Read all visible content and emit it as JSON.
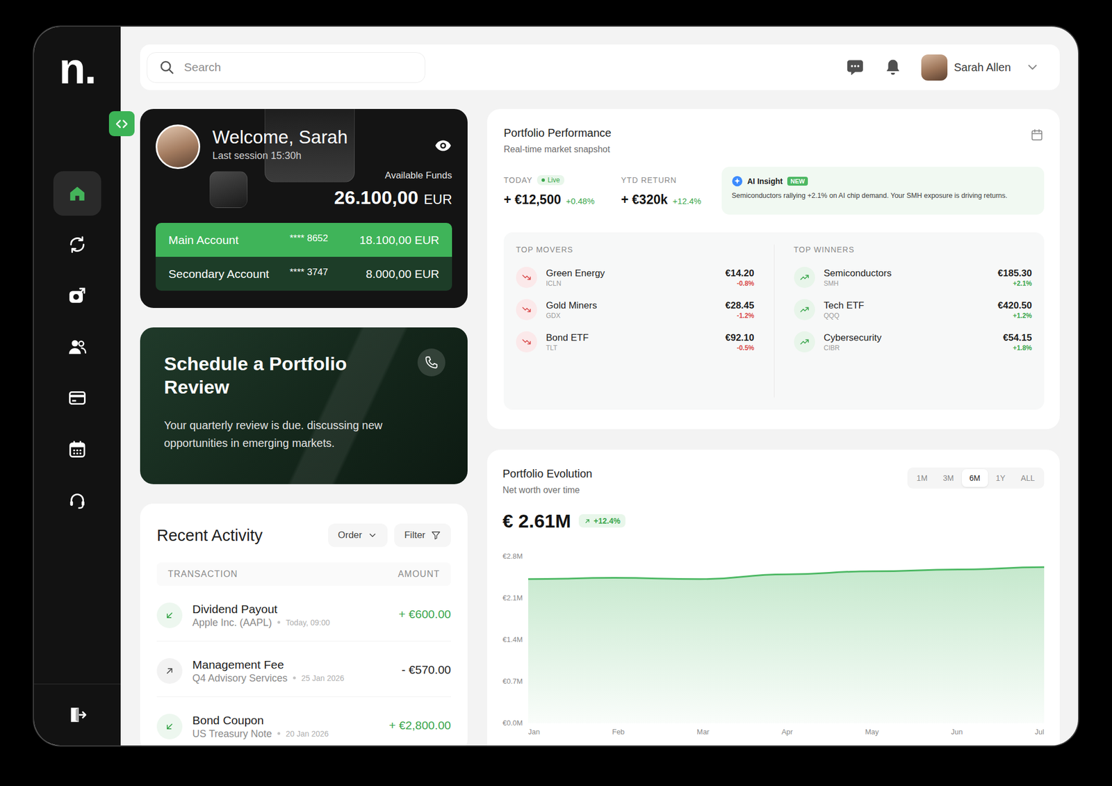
{
  "sidebar": {
    "logo": "n.",
    "items": [
      {
        "selected": true
      },
      {
        "selected": false
      },
      {
        "selected": false
      },
      {
        "selected": false
      },
      {
        "selected": false
      },
      {
        "selected": false
      },
      {
        "selected": false
      }
    ]
  },
  "topbar": {
    "search_placeholder": "Search",
    "user": {
      "name": "Sarah Allen"
    }
  },
  "welcome": {
    "greeting": "Welcome, Sarah",
    "last_session": "Last session 15:30h",
    "funds_label": "Available Funds",
    "funds": "26.100,00",
    "currency": "EUR",
    "accounts": [
      {
        "name": "Main Account",
        "number": "**** 8652",
        "balance": "18.100,00 EUR",
        "selected": true
      },
      {
        "name": "Secondary Account",
        "number": "**** 3747",
        "balance": "8.000,00 EUR",
        "selected": false
      }
    ]
  },
  "review": {
    "title": "Schedule a Portfolio Review",
    "text": "Your quarterly review is due. discussing new opportunities in emerging markets."
  },
  "activity": {
    "title": "Recent Activity",
    "order": "Order",
    "filter": "Filter",
    "columns": [
      "TRANSACTION",
      "AMOUNT"
    ],
    "rows": [
      {
        "name": "Dividend Payout",
        "source": "Apple Inc. (AAPL)",
        "time": "Today, 09:00",
        "amount": "+ €600.00",
        "kind": "in"
      },
      {
        "name": "Management Fee",
        "source": "Q4 Advisory Services",
        "time": "25 Jan 2026",
        "amount": "- €570.00",
        "kind": "out"
      },
      {
        "name": "Bond Coupon",
        "source": "US Treasury Note",
        "time": "20 Jan 2026",
        "amount": "+ €2,800.00",
        "kind": "in"
      }
    ]
  },
  "performance": {
    "title": "Portfolio Performance",
    "subtitle": "Real-time market snapshot",
    "today": {
      "label": "TODAY",
      "badge": "Live",
      "value": "+ €12,500",
      "change": "+0.48%"
    },
    "ytd": {
      "label": "YTD RETURN",
      "value": "+ €320k",
      "change": "+12.4%"
    },
    "insight": {
      "label": "AI Insight",
      "badge": "NEW",
      "text": "Semiconductors rallying +2.1% on AI chip demand. Your SMH exposure is driving returns."
    },
    "movers": {
      "title": "TOP MOVERS",
      "items": [
        {
          "name": "Green Energy",
          "ticker": "ICLN",
          "price": "€14.20",
          "change": "-0.8%",
          "kind": "down"
        },
        {
          "name": "Gold Miners",
          "ticker": "GDX",
          "price": "€28.45",
          "change": "-1.2%",
          "kind": "down"
        },
        {
          "name": "Bond ETF",
          "ticker": "TLT",
          "price": "€92.10",
          "change": "-0.5%",
          "kind": "down"
        }
      ]
    },
    "winners": {
      "title": "TOP WINNERS",
      "items": [
        {
          "name": "Semiconductors",
          "ticker": "SMH",
          "price": "€185.30",
          "change": "+2.1%",
          "kind": "up"
        },
        {
          "name": "Tech ETF",
          "ticker": "QQQ",
          "price": "€420.50",
          "change": "+1.2%",
          "kind": "up"
        },
        {
          "name": "Cybersecurity",
          "ticker": "CIBR",
          "price": "€54.15",
          "change": "+1.8%",
          "kind": "up"
        }
      ]
    }
  },
  "evolution": {
    "title": "Portfolio Evolution",
    "subtitle": "Net worth over time",
    "ranges": [
      {
        "label": "1M",
        "selected": false
      },
      {
        "label": "3M",
        "selected": false
      },
      {
        "label": "6M",
        "selected": true
      },
      {
        "label": "1Y",
        "selected": false
      },
      {
        "label": "ALL",
        "selected": false
      }
    ],
    "value": "€ 2.61M",
    "change": "+12.4%",
    "chart": {
      "y_ticks": [
        "€2.8M",
        "€2.1M",
        "€1.4M",
        "€0.7M",
        "€0.0M"
      ],
      "x_labels": [
        "Jan",
        "Feb",
        "Mar",
        "Apr",
        "May",
        "Jun",
        "Jul"
      ],
      "axis_max": 2.8,
      "series": [
        {
          "values": [
            2.42,
            2.44,
            2.42,
            2.5,
            2.55,
            2.58,
            2.62
          ]
        }
      ]
    }
  }
}
